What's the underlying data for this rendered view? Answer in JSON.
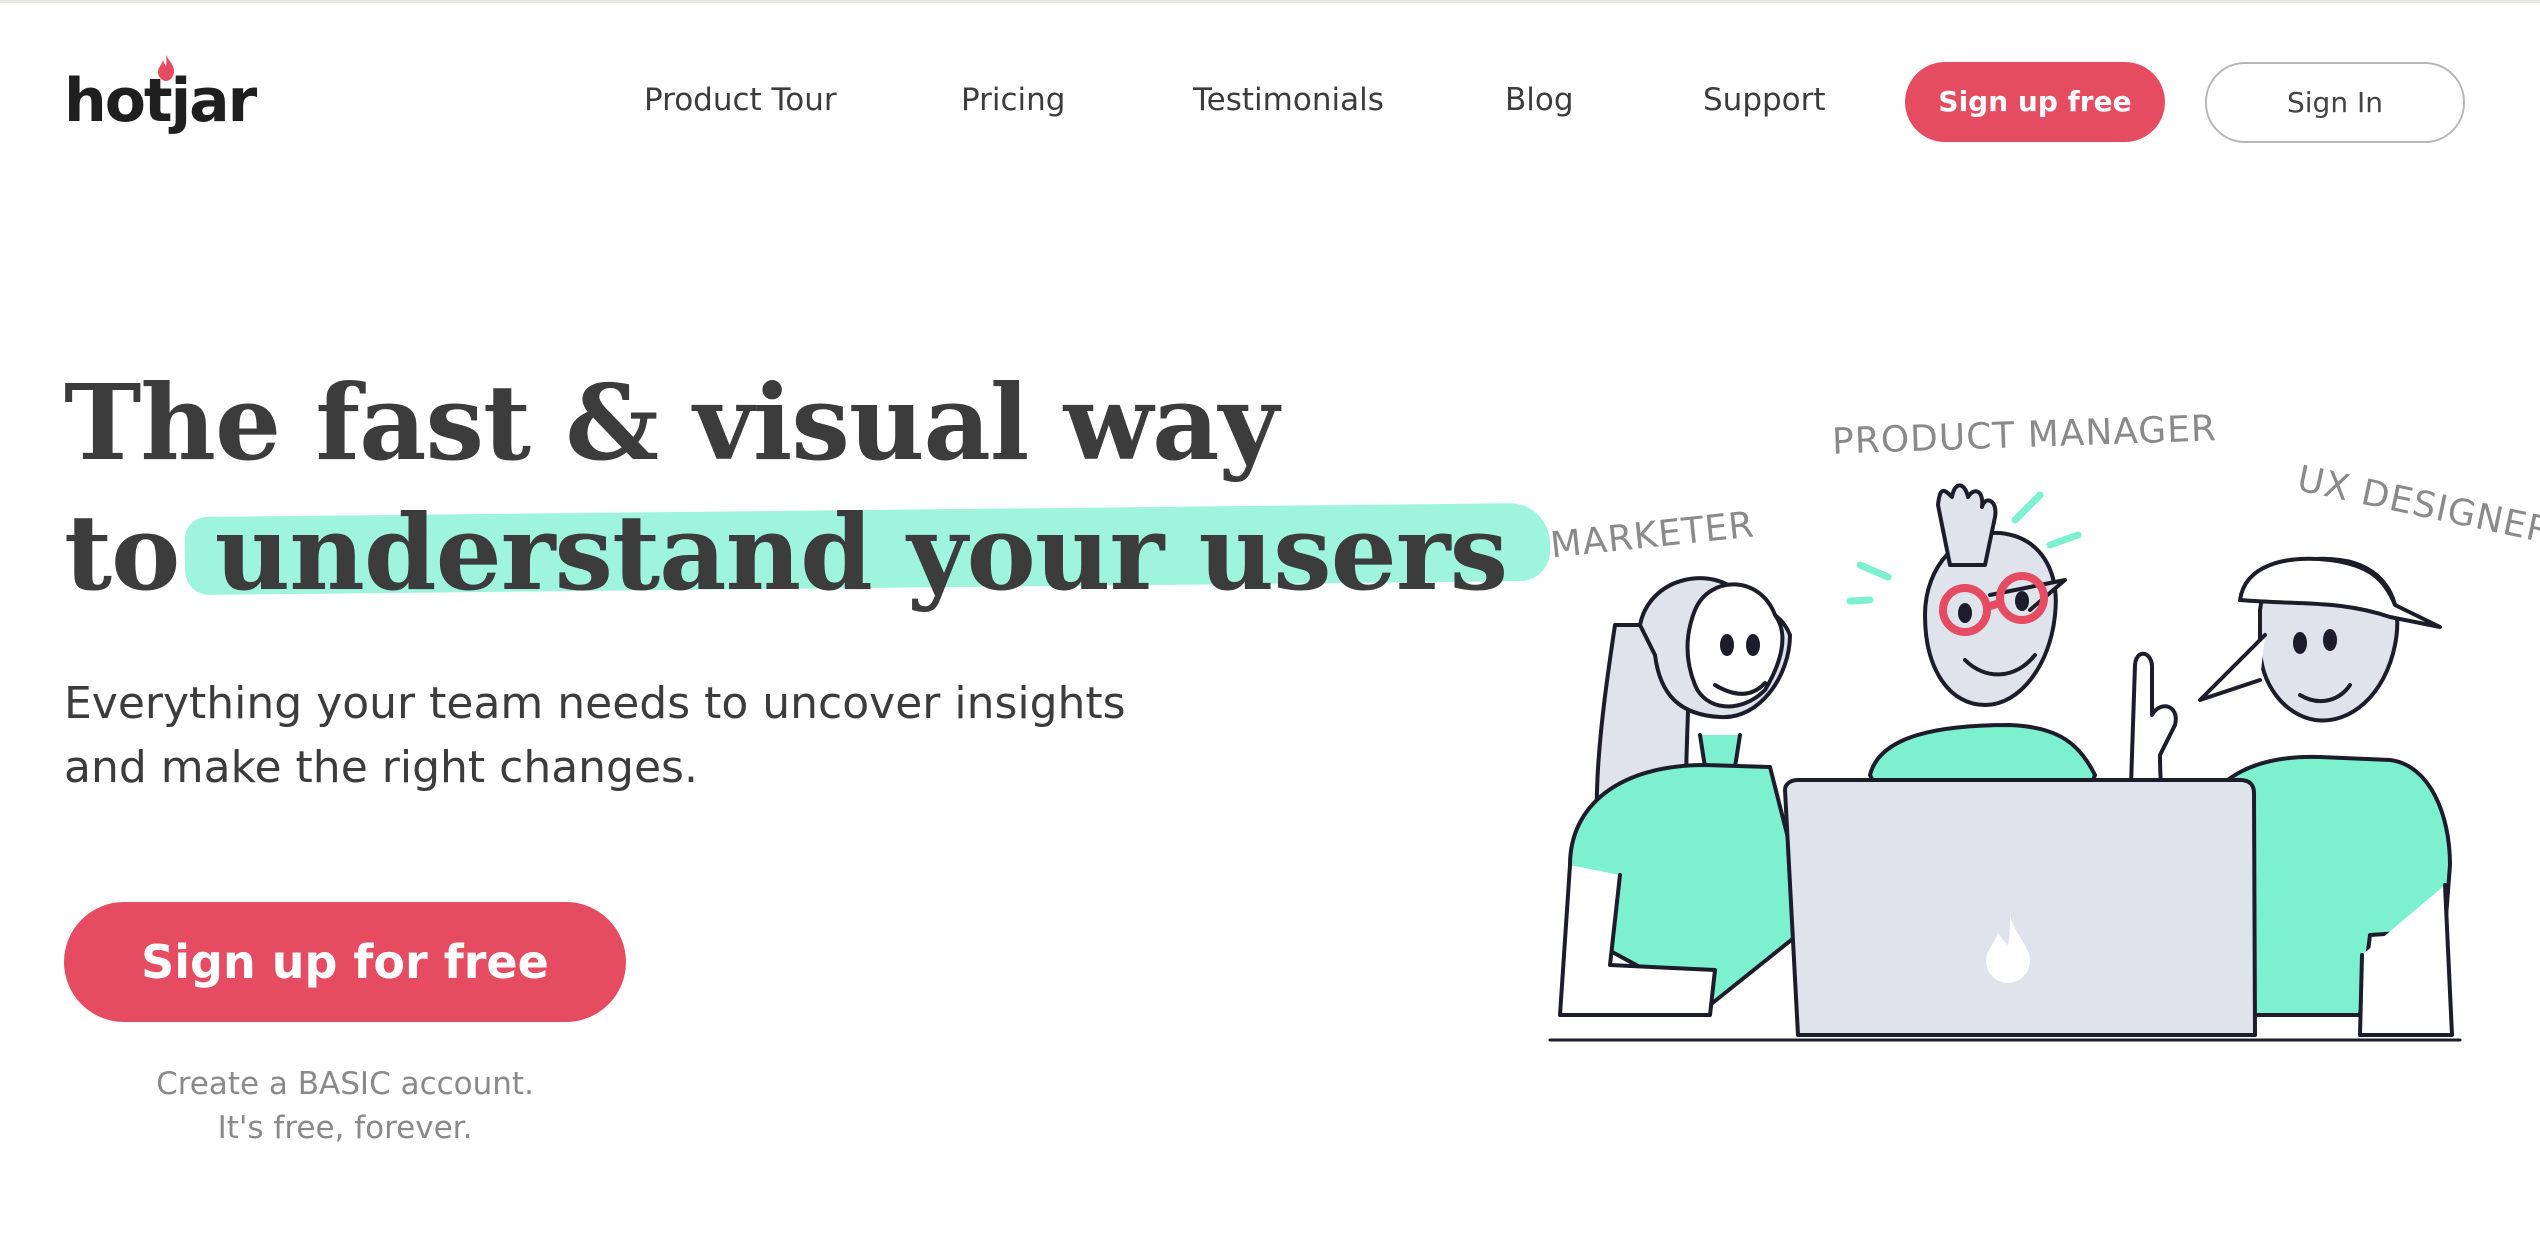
{
  "header": {
    "logo": "hotjar",
    "nav": [
      "Product Tour",
      "Pricing",
      "Testimonials",
      "Blog",
      "Support"
    ],
    "signup_label": "Sign up free",
    "signin_label": "Sign In"
  },
  "hero": {
    "headline_line1": "The fast & visual way",
    "headline_line2_prefix": "to",
    "headline_highlight": "understand your users",
    "subtitle_line1": "Everything your team needs to uncover insights",
    "subtitle_line2": "and make the right changes.",
    "cta_label": "Sign up for free",
    "cta_note_line1": "Create a BASIC account.",
    "cta_note_line2": "It's free, forever."
  },
  "illustration": {
    "labels": {
      "marketer": "MARKETER",
      "product_manager": "PRODUCT MANAGER",
      "ux_designer": "UX DESIGNER"
    }
  },
  "colors": {
    "brand": "#e64c61",
    "highlight": "#7df1cf",
    "text": "#3c3c3c",
    "muted": "#8a8a8a"
  }
}
